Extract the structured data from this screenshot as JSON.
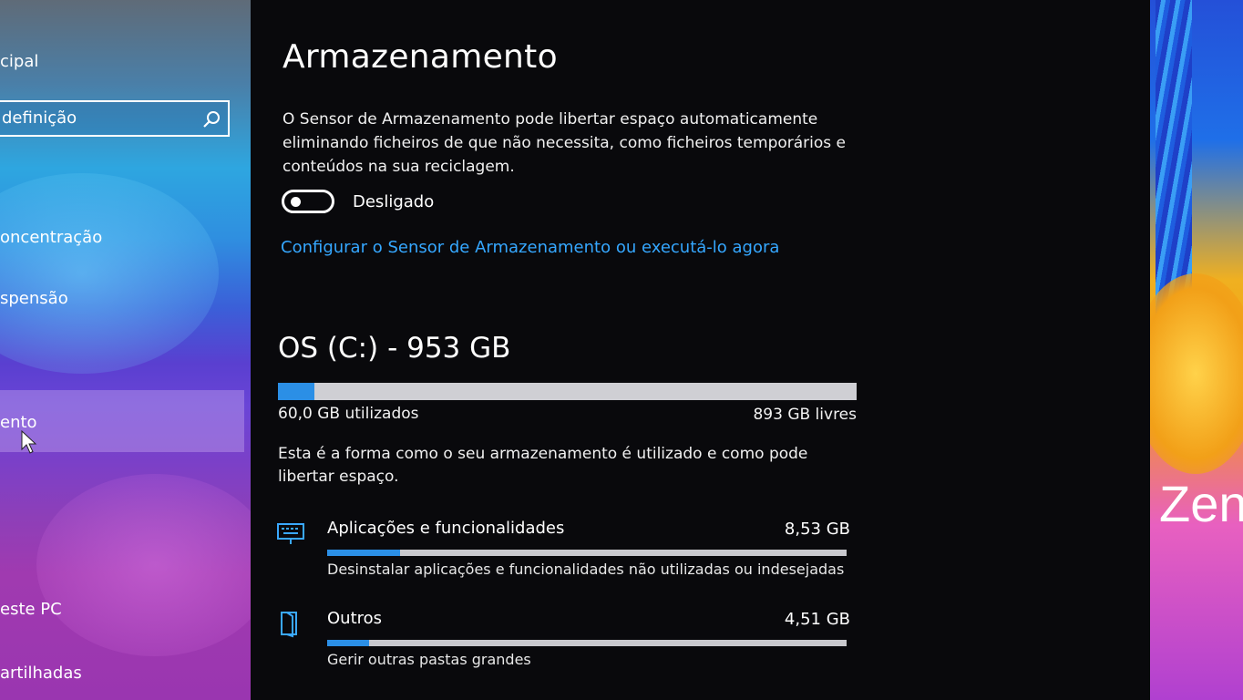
{
  "sidebar": {
    "items": [
      {
        "label": "cipal"
      },
      {
        "label": "oncentração"
      },
      {
        "label": "spensão"
      },
      {
        "label": "ento"
      },
      {
        "label": "este PC"
      },
      {
        "label": "artilhadas"
      }
    ],
    "search": {
      "value": "definição",
      "icon": "search-icon"
    }
  },
  "main": {
    "title": "Armazenamento",
    "description": "O Sensor de Armazenamento pode libertar espaço automaticamente eliminando ficheiros de que não necessita, como ficheiros temporários e conteúdos na sua reciclagem.",
    "toggle": {
      "state": "off",
      "label": "Desligado"
    },
    "configure_link": "Configurar o Sensor de Armazenamento ou executá-lo agora",
    "drive": {
      "title": "OS (C:) - 953 GB",
      "used_label": "60,0 GB utilizados",
      "free_label": "893 GB livres",
      "used_fraction": 0.063
    },
    "info_text": "Esta é a forma como o seu armazenamento é utilizado e como pode libertar espaço.",
    "categories": [
      {
        "name": "Aplicações e funcionalidades",
        "size": "8,53 GB",
        "subtitle": "Desinstalar aplicações e funcionalidades não utilizadas ou indesejadas",
        "icon": "keyboard-icon",
        "fill_fraction": 0.14
      },
      {
        "name": "Outros",
        "size": "4,51 GB",
        "subtitle": "Gerir outras pastas grandes",
        "icon": "folder-icon",
        "fill_fraction": 0.08
      }
    ]
  },
  "desktop": {
    "wallpaper_text": "Zen"
  },
  "colors": {
    "accent": "#2b8fe6",
    "link": "#35a7ff",
    "background": "#09090c"
  }
}
